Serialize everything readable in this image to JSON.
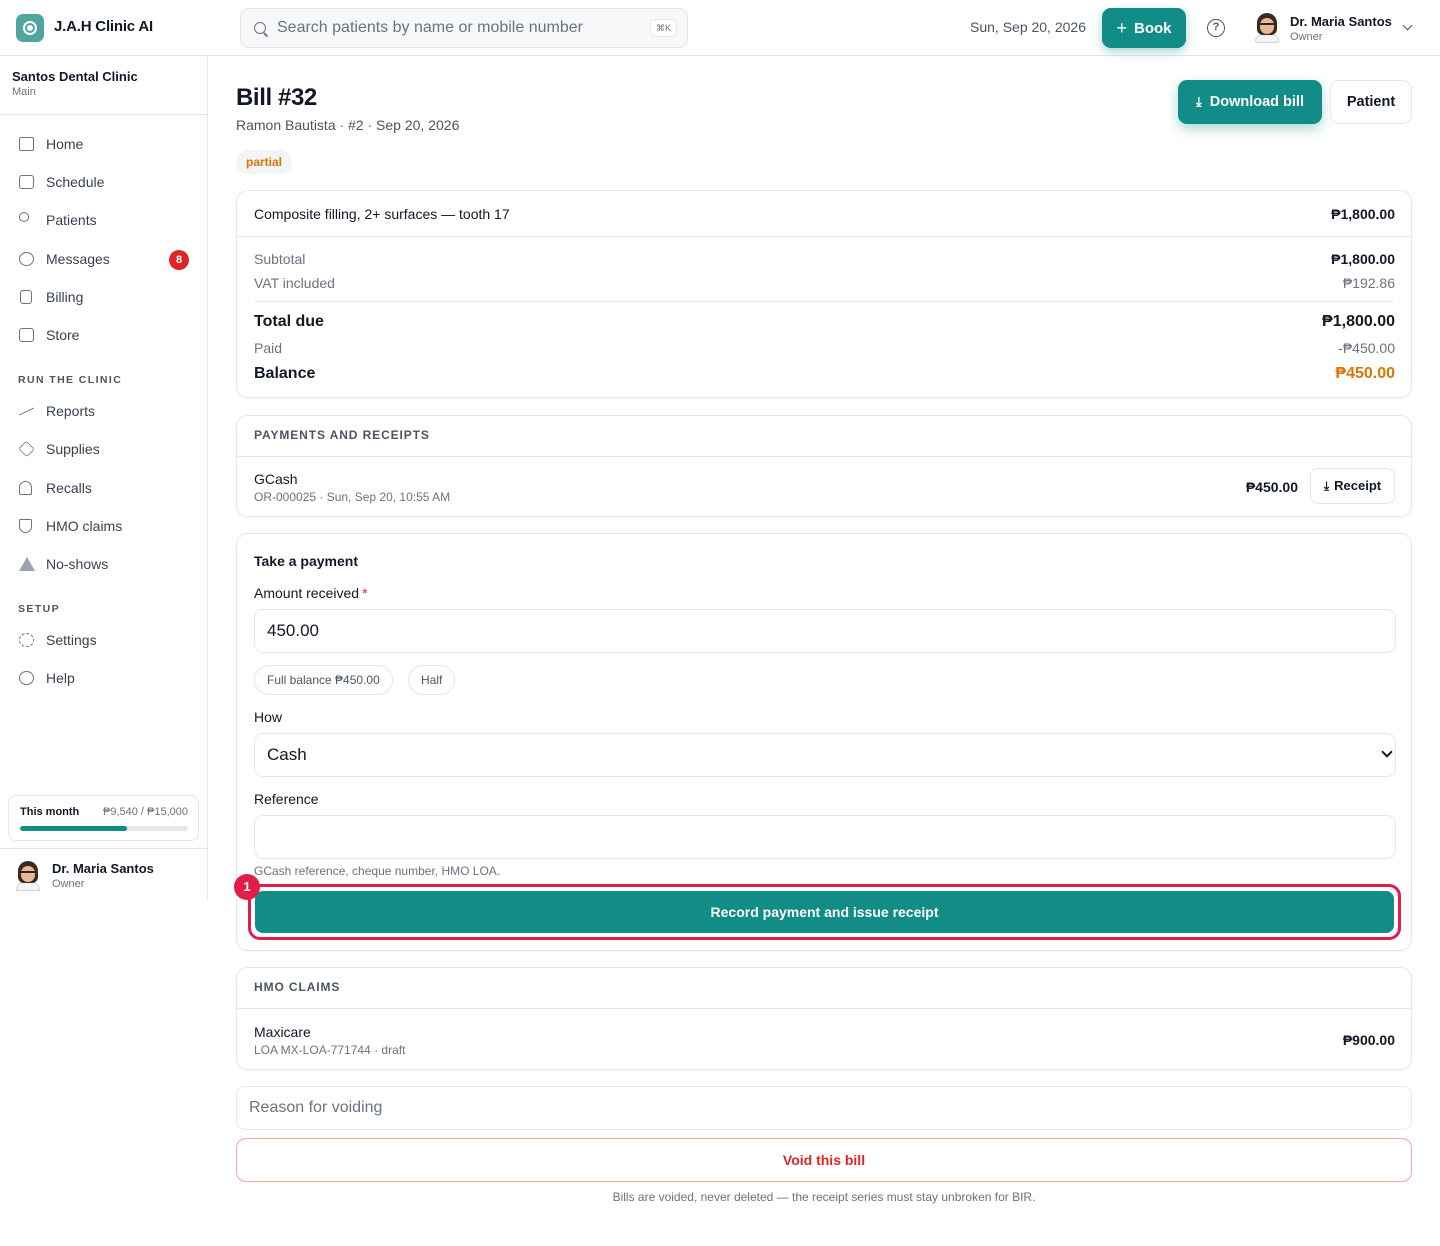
{
  "app": {
    "title": "J.A.H Clinic AI"
  },
  "search": {
    "placeholder": "Search patients by name or mobile number",
    "shortcut": "⌘K"
  },
  "header": {
    "date": "Sun, Sep 20, 2026",
    "book_label": "Book",
    "user_name": "Dr. Maria Santos",
    "user_role": "Owner"
  },
  "clinic": {
    "name": "Santos Dental Clinic",
    "branch": "Main"
  },
  "nav": {
    "main": [
      {
        "label": "Home",
        "icon": "home-icon"
      },
      {
        "label": "Schedule",
        "icon": "calendar-icon"
      },
      {
        "label": "Patients",
        "icon": "users-icon"
      },
      {
        "label": "Messages",
        "icon": "message-icon",
        "badge": "8"
      },
      {
        "label": "Billing",
        "icon": "receipt-icon"
      },
      {
        "label": "Store",
        "icon": "shopping-bag-icon"
      }
    ],
    "run_title": "RUN THE CLINIC",
    "run": [
      {
        "label": "Reports",
        "icon": "trending-up-icon"
      },
      {
        "label": "Supplies",
        "icon": "package-icon"
      },
      {
        "label": "Recalls",
        "icon": "bell-icon"
      },
      {
        "label": "HMO claims",
        "icon": "shield-icon"
      },
      {
        "label": "No-shows",
        "icon": "warning-icon"
      }
    ],
    "setup_title": "SETUP",
    "setup": [
      {
        "label": "Settings",
        "icon": "gear-icon"
      },
      {
        "label": "Help",
        "icon": "help-icon"
      }
    ]
  },
  "usage": {
    "label": "This month",
    "value": "₱9,540 / ₱15,000",
    "progress": 0.636
  },
  "bill": {
    "title": "Bill #32",
    "subtitle": "Ramon Bautista · #2 · Sep 20, 2026",
    "status": "partial",
    "download_label": "Download bill",
    "patient_label": "Patient",
    "line_item": {
      "description": "Composite filling, 2+ surfaces — tooth 17",
      "amount": "₱1,800.00"
    },
    "subtotal_label": "Subtotal",
    "subtotal": "₱1,800.00",
    "vat_label": "VAT included",
    "vat": "₱192.86",
    "total_label": "Total due",
    "total": "₱1,800.00",
    "paid_label": "Paid",
    "paid": "-₱450.00",
    "balance_label": "Balance",
    "balance": "₱450.00"
  },
  "payments": {
    "title": "PAYMENTS AND RECEIPTS",
    "items": [
      {
        "method": "GCash",
        "detail": "OR-000025 · Sun, Sep 20, 10:55 AM",
        "amount": "₱450.00",
        "receipt_label": "Receipt"
      }
    ]
  },
  "take_payment": {
    "title": "Take a payment",
    "amount_label": "Amount received",
    "required_mark": "*",
    "amount_value": "450.00",
    "chip_full": "Full balance ₱450.00",
    "chip_half": "Half",
    "how_label": "How",
    "how_value": "Cash",
    "reference_label": "Reference",
    "reference_value": "",
    "reference_hint": "GCash reference, cheque number, HMO LOA.",
    "submit_label": "Record payment and issue receipt",
    "step_badge": "1"
  },
  "hmo": {
    "title": "HMO CLAIMS",
    "items": [
      {
        "provider": "Maxicare",
        "detail": "LOA MX-LOA-771744 · draft",
        "amount": "₱900.00"
      }
    ]
  },
  "void": {
    "placeholder": "Reason for voiding",
    "button_label": "Void this bill",
    "note": "Bills are voided, never deleted — the receipt series must stay unbroken for BIR."
  },
  "colors": {
    "accent": "#128c86",
    "danger": "#dc2626",
    "warning": "#d97706",
    "highlight": "#e11d48"
  }
}
